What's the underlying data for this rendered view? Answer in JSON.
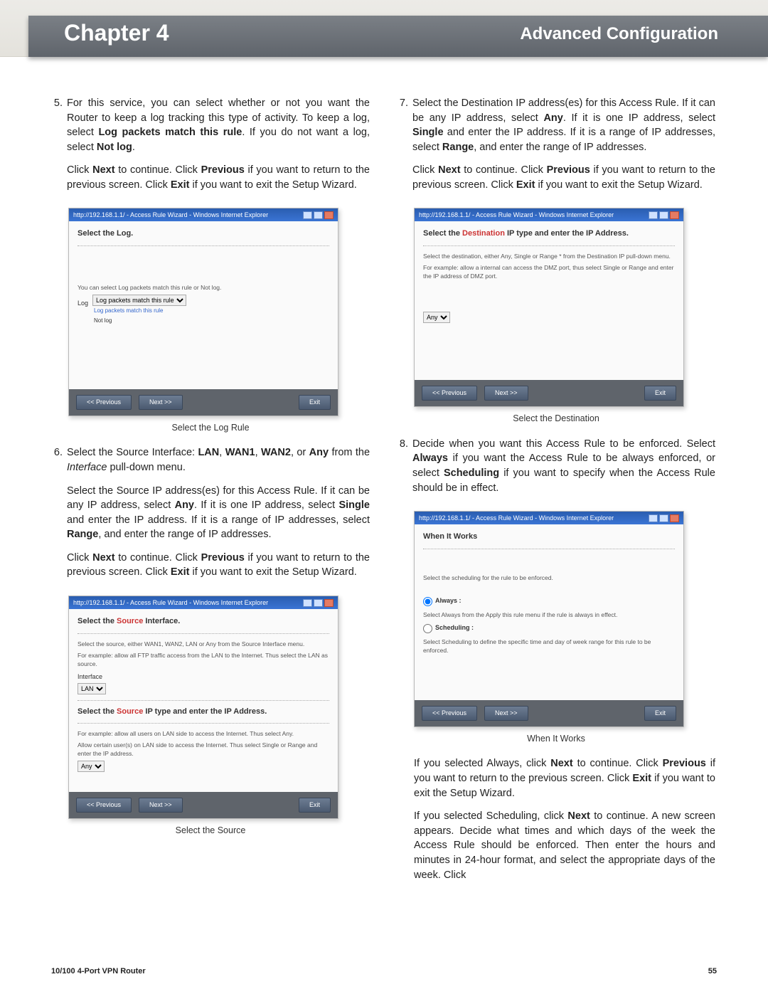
{
  "header": {
    "chapter": "Chapter 4",
    "section": "Advanced Configuration"
  },
  "left": {
    "step5": {
      "num": "5.",
      "p1a": "For this service, you can select whether or not you want the Router to keep a log tracking this type of activity. To keep a log, select ",
      "p1b": "Log packets match this rule",
      "p1c": ". If you do not want a log, select ",
      "p1d": "Not log",
      "p1e": ".",
      "p2a": "Click ",
      "p2b": "Next",
      "p2c": " to continue. Click ",
      "p2d": "Previous",
      "p2e": " if you want to return to the previous screen. Click ",
      "p2f": "Exit",
      "p2g": " if you want to exit the Setup Wizard."
    },
    "step6": {
      "num": "6.",
      "p1a": "Select the Source Interface: ",
      "p1b": "LAN",
      "p1c": ", ",
      "p1d": "WAN1",
      "p1e": ", ",
      "p1f": "WAN2",
      "p1g": ", or ",
      "p1h": "Any",
      "p1i": " from the ",
      "p1j": "Interface",
      "p1k": " pull-down menu.",
      "p2a": "Select the Source IP address(es) for this Access Rule. If it can be any IP address, select ",
      "p2b": "Any",
      "p2c": ". If it is one IP address, select ",
      "p2d": "Single",
      "p2e": " and enter the IP address. If it is a range of IP addresses, select ",
      "p2f": "Range",
      "p2g": ", and enter the range of IP addresses.",
      "p3a": "Click ",
      "p3b": "Next",
      "p3c": " to continue. Click ",
      "p3d": "Previous",
      "p3e": " if you want to return to the previous screen. Click ",
      "p3f": "Exit",
      "p3g": " if you want to exit the Setup Wizard."
    },
    "caption1": "Select the Log Rule",
    "caption2": "Select the Source"
  },
  "right": {
    "step7": {
      "num": "7.",
      "p1a": "Select the Destination IP address(es) for this Access Rule. If it can be any IP address, select ",
      "p1b": "Any",
      "p1c": ". If it is one IP address, select ",
      "p1d": "Single",
      "p1e": " and enter the IP address. If it is a range of IP addresses, select ",
      "p1f": "Range",
      "p1g": ", and enter the range of IP addresses.",
      "p2a": "Click ",
      "p2b": "Next",
      "p2c": " to continue. Click ",
      "p2d": "Previous",
      "p2e": " if you want to return to the previous screen. Click ",
      "p2f": "Exit",
      "p2g": " if you want to exit the Setup Wizard."
    },
    "step8": {
      "num": "8.",
      "p1a": "Decide when you want this Access Rule to be enforced. Select ",
      "p1b": "Always",
      "p1c": " if you want the Access Rule to be always enforced, or select ",
      "p1d": "Scheduling",
      "p1e": " if you want to specify when the Access Rule should be in effect.",
      "p2a": "If you selected Always, click ",
      "p2b": "Next",
      "p2c": " to continue. Click ",
      "p2d": "Previous",
      "p2e": " if you want to return to the previous screen. Click ",
      "p2f": "Exit",
      "p2g": " if you want to exit the Setup Wizard.",
      "p3a": "If you selected Scheduling, click ",
      "p3b": "Next",
      "p3c": " to continue. A new screen appears. Decide what times and which days of the week the Access Rule should be enforced. Then enter the hours and minutes in 24-hour format, and select the appropriate days of the week. Click"
    },
    "caption1": "Select the Destination",
    "caption2": "When It Works"
  },
  "mock": {
    "titlebar": "http://192.168.1.1/ - Access Rule Wizard - Windows Internet Explorer",
    "btn_prev": "<< Previous",
    "btn_next": "Next >>",
    "btn_exit": "Exit",
    "log": {
      "heading": "Select the Log.",
      "hint": "You can select Log packets match this rule or Not log.",
      "label": "Log",
      "opt1": "Log packets match this rule",
      "opt2": "Not log"
    },
    "src": {
      "heading_a": "Select the ",
      "heading_b": "Source",
      "heading_c": " Interface.",
      "hint1": "Select the source, either WAN1, WAN2, LAN or Any from the Source Interface menu.",
      "hint2": "For example: allow all FTP traffic access from the LAN to the Internet. Thus select the LAN as source.",
      "label_iface": "Interface",
      "opt_iface": "LAN",
      "heading2_a": "Select the ",
      "heading2_b": "Source",
      "heading2_c": " IP type and enter the IP Address.",
      "hint3": "For example: allow all users on LAN side to access the Internet. Thus select Any.",
      "hint4": "Allow certain user(s) on LAN side to access the Internet. Thus select Single or Range and enter the IP address.",
      "opt_any": "Any"
    },
    "dst": {
      "heading_a": "Select the ",
      "heading_b": "Destination",
      "heading_c": " IP type and enter the IP Address.",
      "hint1": "Select the destination, either Any, Single or Range * from the Destination IP pull-down menu.",
      "hint2": "For example: allow a internal can access the DMZ port, thus select Single or Range and enter the IP address of DMZ port.",
      "opt_any": "Any"
    },
    "when": {
      "heading": "When It Works",
      "hint": "Select the scheduling for the rule to be enforced.",
      "r1": "Always :",
      "r1d": "Select Always from the Apply this rule menu if the rule is always in effect.",
      "r2": "Scheduling :",
      "r2d": "Select Scheduling to define the specific time and day of week range for this rule to be enforced."
    }
  },
  "footer": {
    "left": "10/100 4-Port VPN Router",
    "right": "55"
  }
}
